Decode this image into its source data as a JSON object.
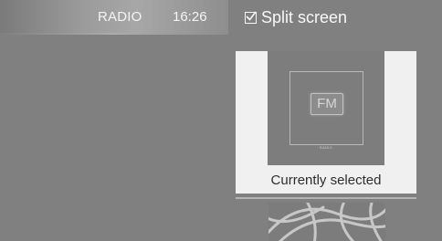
{
  "status_bar": {
    "source": "RADIO",
    "time": "16:26"
  },
  "split_screen": {
    "label": "Split screen",
    "checked": true
  },
  "carousel": {
    "selected": {
      "icon_text": "FM",
      "thumb_caption": "RADIO",
      "label": "Currently selected"
    },
    "next_item_icon": "abstract-lines-icon"
  },
  "colors": {
    "background": "#808080",
    "card_background": "#f0f0f0",
    "text_light": "#f4f4f4"
  }
}
